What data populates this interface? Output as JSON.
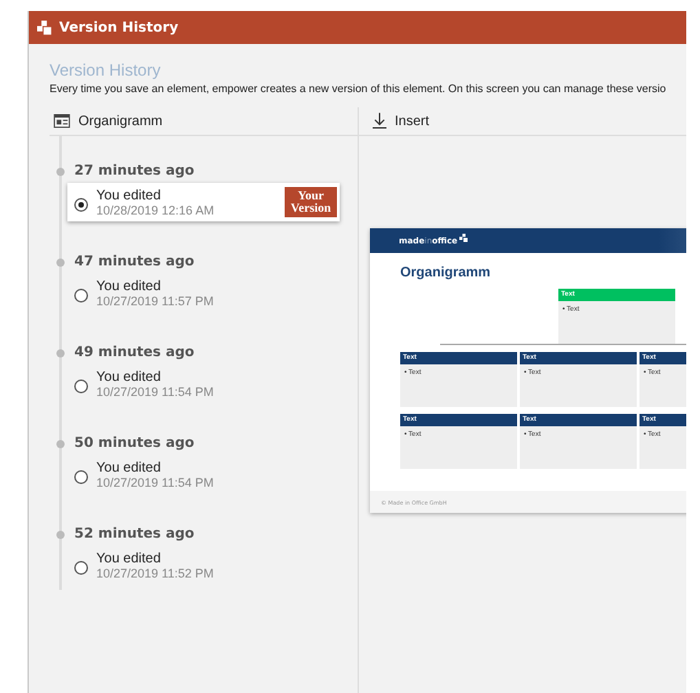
{
  "window": {
    "title": "Version History"
  },
  "heading": "Version History",
  "description": "Every time you save an element, empower creates a new version of this element. On this screen you can manage these versio",
  "left_header": {
    "label": "Organigramm"
  },
  "right_header": {
    "label": "Insert"
  },
  "versions": [
    {
      "time": "27 minutes ago",
      "action": "You edited",
      "date": "10/28/2019 12:16 AM",
      "selected": true,
      "badge": "Your Version"
    },
    {
      "time": "47 minutes ago",
      "action": "You edited",
      "date": "10/27/2019 11:57 PM",
      "selected": false
    },
    {
      "time": "49 minutes ago",
      "action": "You edited",
      "date": "10/27/2019 11:54 PM",
      "selected": false
    },
    {
      "time": "50 minutes ago",
      "action": "You edited",
      "date": "10/27/2019 11:54 PM",
      "selected": false
    },
    {
      "time": "52 minutes ago",
      "action": "You edited",
      "date": "10/27/2019 11:52 PM",
      "selected": false
    }
  ],
  "preview": {
    "logo": [
      {
        "text": "made",
        "dim": false
      },
      {
        "text": "in",
        "dim": true
      },
      {
        "text": "office",
        "dim": false
      }
    ],
    "title": "Organigramm",
    "top_box": {
      "header": "Text",
      "bullet": "• Text",
      "color": "#00c060"
    },
    "rows": [
      [
        {
          "header": "Text",
          "bullet": "• Text"
        },
        {
          "header": "Text",
          "bullet": "• Text"
        },
        {
          "header": "Text",
          "bullet": "• Text"
        }
      ],
      [
        {
          "header": "Text",
          "bullet": "• Text"
        },
        {
          "header": "Text",
          "bullet": "• Text"
        },
        {
          "header": "Text",
          "bullet": "• Text"
        }
      ]
    ],
    "footer": "© Made in Office GmbH"
  }
}
